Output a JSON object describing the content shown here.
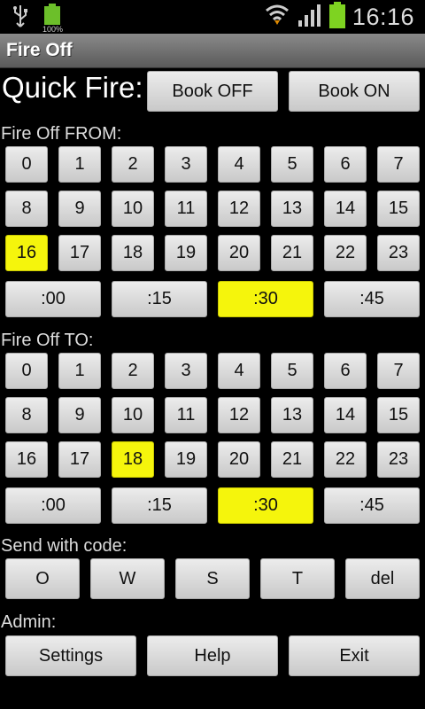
{
  "status_bar": {
    "time": "16:16",
    "battery_percent": "100%",
    "icons": [
      "usb-icon",
      "battery-icon",
      "wifi-icon",
      "signal-icon",
      "battery-full-icon"
    ]
  },
  "app": {
    "title": "Fire Off"
  },
  "quick_fire": {
    "label": "Quick Fire:",
    "book_off": "Book OFF",
    "book_on": "Book ON"
  },
  "from": {
    "label": "Fire Off FROM:",
    "hours": [
      "0",
      "1",
      "2",
      "3",
      "4",
      "5",
      "6",
      "7",
      "8",
      "9",
      "10",
      "11",
      "12",
      "13",
      "14",
      "15",
      "16",
      "17",
      "18",
      "19",
      "20",
      "21",
      "22",
      "23"
    ],
    "minutes": [
      ":00",
      ":15",
      ":30",
      ":45"
    ],
    "selected_hour": "16",
    "selected_minute": ":30"
  },
  "to": {
    "label": "Fire Off TO:",
    "hours": [
      "0",
      "1",
      "2",
      "3",
      "4",
      "5",
      "6",
      "7",
      "8",
      "9",
      "10",
      "11",
      "12",
      "13",
      "14",
      "15",
      "16",
      "17",
      "18",
      "19",
      "20",
      "21",
      "22",
      "23"
    ],
    "minutes": [
      ":00",
      ":15",
      ":30",
      ":45"
    ],
    "selected_hour": "18",
    "selected_minute": ":30"
  },
  "code": {
    "label": "Send with code:",
    "buttons": [
      "O",
      "W",
      "S",
      "T",
      "del"
    ]
  },
  "admin": {
    "label": "Admin:",
    "buttons": [
      "Settings",
      "Help",
      "Exit"
    ]
  },
  "colors": {
    "selected": "#f5f50c",
    "button": "#dcdcdc",
    "background": "#000000"
  }
}
